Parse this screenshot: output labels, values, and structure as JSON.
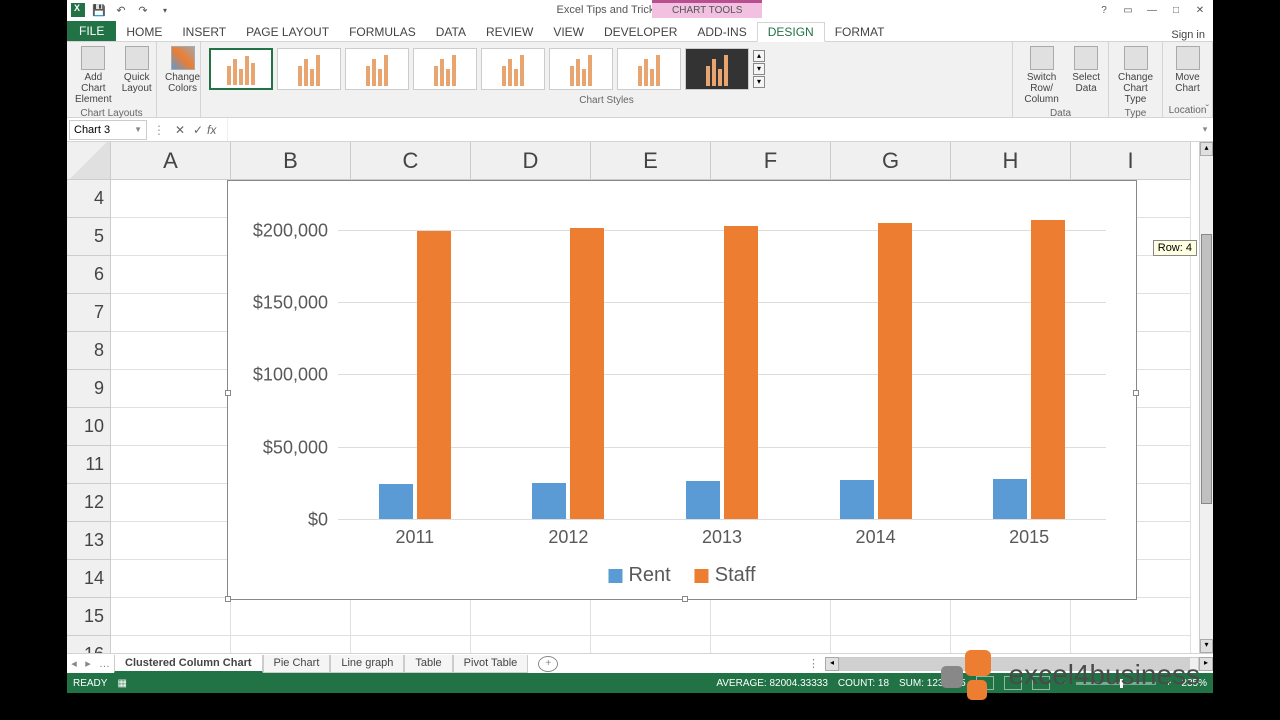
{
  "app": {
    "title": "Excel Tips and Tricks Final - Excel",
    "context_tab": "CHART TOOLS",
    "signin": "Sign in"
  },
  "ribbon": {
    "tabs": [
      "FILE",
      "HOME",
      "INSERT",
      "PAGE LAYOUT",
      "FORMULAS",
      "DATA",
      "REVIEW",
      "VIEW",
      "DEVELOPER",
      "ADD-INS",
      "DESIGN",
      "FORMAT"
    ],
    "layouts": {
      "add_element": "Add Chart Element",
      "quick_layout": "Quick Layout",
      "group": "Chart Layouts"
    },
    "colors": {
      "change": "Change Colors"
    },
    "styles_group": "Chart Styles",
    "data_group": {
      "switch": "Switch Row/ Column",
      "select": "Select Data",
      "group": "Data"
    },
    "type_group": {
      "change": "Change Chart Type",
      "group": "Type"
    },
    "loc_group": {
      "move": "Move Chart",
      "group": "Location"
    }
  },
  "name_box": "Chart 3",
  "columns": [
    "A",
    "B",
    "C",
    "D",
    "E",
    "F",
    "G",
    "H",
    "I"
  ],
  "rows": [
    "4",
    "5",
    "6",
    "7",
    "8",
    "9",
    "10",
    "11",
    "12",
    "13",
    "14",
    "15",
    "16"
  ],
  "row_tooltip": "Row: 4",
  "chart_data": {
    "type": "bar",
    "categories": [
      "2011",
      "2012",
      "2013",
      "2014",
      "2015"
    ],
    "series": [
      {
        "name": "Rent",
        "values": [
          24000,
          25000,
          26000,
          27000,
          28000
        ],
        "color": "#5b9bd5"
      },
      {
        "name": "Staff",
        "values": [
          199000,
          201000,
          203000,
          205000,
          207000
        ],
        "color": "#ed7d31"
      }
    ],
    "y_ticks": [
      "$0",
      "$50,000",
      "$100,000",
      "$150,000",
      "$200,000"
    ],
    "ylim": [
      0,
      220000
    ]
  },
  "watermark": "excel4business",
  "sheets": {
    "list": [
      "Clustered Column Chart",
      "Pie Chart",
      "Line graph",
      "Table",
      "Pivot Table"
    ],
    "active": 0
  },
  "status": {
    "ready": "READY",
    "avg": "AVERAGE: 82004.33333",
    "count": "COUNT: 18",
    "sum": "SUM: 1230065",
    "zoom": "235%"
  }
}
